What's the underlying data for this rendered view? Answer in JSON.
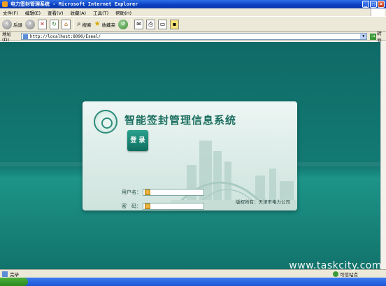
{
  "window": {
    "title": "电力签封管理系统 - Microsoft Internet Explorer",
    "buttons": [
      "_",
      "□",
      "×"
    ]
  },
  "menubar": {
    "items": [
      "文件(F)",
      "编辑(E)",
      "查看(V)",
      "收藏(A)",
      "工具(T)",
      "帮助(H)"
    ]
  },
  "toolbar": {
    "back_label": "后退",
    "search_label": "搜索",
    "favorites_label": "收藏夹"
  },
  "addressbar": {
    "label": "地址(D)",
    "url": "http://localhost:8090/Eseal/",
    "go_label": "转到"
  },
  "login": {
    "system_title": "智能签封管理信息系统",
    "username_label": "用户名：",
    "password_label": "密　码：",
    "username_value": "",
    "password_value": "",
    "login_button": "登 录",
    "copyright": "版权所有：天津市电力公司"
  },
  "statusbar": {
    "status_text": "完毕",
    "zone_text": "可信站点"
  },
  "watermark": "www.taskcity.com"
}
